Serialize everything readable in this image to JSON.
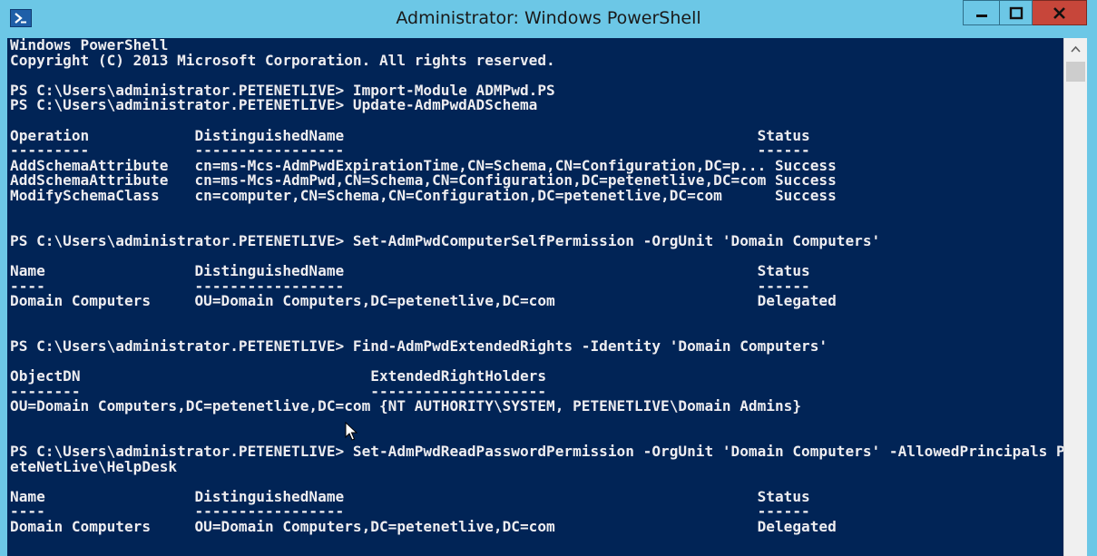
{
  "window": {
    "title": "Administrator: Windows PowerShell",
    "icon": "powershell-icon"
  },
  "controls": {
    "minimize_icon": "minimize-icon",
    "maximize_icon": "maximize-icon",
    "close_icon": "close-icon"
  },
  "console": {
    "lines": [
      "Windows PowerShell",
      "Copyright (C) 2013 Microsoft Corporation. All rights reserved.",
      "",
      "PS C:\\Users\\administrator.PETENETLIVE> Import-Module ADMPwd.PS",
      "PS C:\\Users\\administrator.PETENETLIVE> Update-AdmPwdADSchema",
      "",
      "Operation            DistinguishedName                                               Status",
      "---------            -----------------                                               ------",
      "AddSchemaAttribute   cn=ms-Mcs-AdmPwdExpirationTime,CN=Schema,CN=Configuration,DC=p... Success",
      "AddSchemaAttribute   cn=ms-Mcs-AdmPwd,CN=Schema,CN=Configuration,DC=petenetlive,DC=com Success",
      "ModifySchemaClass    cn=computer,CN=Schema,CN=Configuration,DC=petenetlive,DC=com      Success",
      "",
      "",
      "PS C:\\Users\\administrator.PETENETLIVE> Set-AdmPwdComputerSelfPermission -OrgUnit 'Domain Computers'",
      "",
      "Name                 DistinguishedName                                               Status",
      "----                 -----------------                                               ------",
      "Domain Computers     OU=Domain Computers,DC=petenetlive,DC=com                       Delegated",
      "",
      "",
      "PS C:\\Users\\administrator.PETENETLIVE> Find-AdmPwdExtendedRights -Identity 'Domain Computers'",
      "",
      "ObjectDN                                 ExtendedRightHolders",
      "--------                                 --------------------",
      "OU=Domain Computers,DC=petenetlive,DC=com {NT AUTHORITY\\SYSTEM, PETENETLIVE\\Domain Admins}",
      "",
      "",
      "PS C:\\Users\\administrator.PETENETLIVE> Set-AdmPwdReadPasswordPermission -OrgUnit 'Domain Computers' -AllowedPrincipals P",
      "eteNetLive\\HelpDesk",
      "",
      "Name                 DistinguishedName                                               Status",
      "----                 -----------------                                               ------",
      "Domain Computers     OU=Domain Computers,DC=petenetlive,DC=com                       Delegated",
      ""
    ]
  },
  "scrollbar": {
    "up_icon": "scroll-up-arrow-icon"
  },
  "colors": {
    "console_background": "#012456",
    "console_text": "#eeedf0",
    "titlebar": "#6cc7e6",
    "close_button": "#c7463a"
  }
}
